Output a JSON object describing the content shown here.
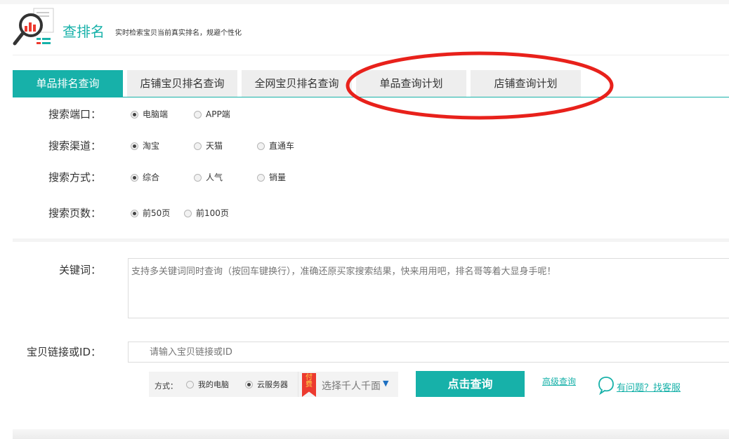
{
  "header": {
    "title": "查排名",
    "subtitle": "实时检索宝贝当前真实排名，规避个性化",
    "logo_icon": "magnifier-chart-icon"
  },
  "tabs": [
    {
      "label": "单品排名查询",
      "active": true
    },
    {
      "label": "店铺宝贝排名查询",
      "active": false
    },
    {
      "label": "全网宝贝排名查询",
      "active": false
    },
    {
      "label": "单品查询计划",
      "active": false
    },
    {
      "label": "店铺查询计划",
      "active": false
    }
  ],
  "filters": {
    "port": {
      "label": "搜索端口：",
      "options": [
        "电脑端",
        "APP端"
      ],
      "selected": "电脑端"
    },
    "channel": {
      "label": "搜索渠道：",
      "options": [
        "淘宝",
        "天猫",
        "直通车"
      ],
      "selected": "淘宝"
    },
    "method": {
      "label": "搜索方式：",
      "options": [
        "综合",
        "人气",
        "销量"
      ],
      "selected": "综合"
    },
    "pages": {
      "label": "搜索页数：",
      "options": [
        "前50页",
        "前100页"
      ],
      "selected": "前50页"
    }
  },
  "keyword": {
    "label": "关键词：",
    "placeholder": "支持多关键词同时查询（按回车键换行），准确还原买家搜索结果，快来用用吧，排名哥等着大显身手呢！"
  },
  "link": {
    "label": "宝贝链接或ID：",
    "placeholder": "请输入宝贝链接或ID"
  },
  "query_method": {
    "label": "方式：",
    "options": [
      "我的电脑",
      "云服务器"
    ],
    "selected": "云服务器"
  },
  "pay_select": {
    "badge": "付费",
    "label": "选择千人千面",
    "arrow": "▼"
  },
  "actions": {
    "query": "点击查询",
    "advanced": "高级查询",
    "help": "有问题？找客服"
  },
  "colors": {
    "accent": "#17b1a9",
    "annotation": "#e8211b",
    "pay_badge": "#ec3a2f"
  }
}
